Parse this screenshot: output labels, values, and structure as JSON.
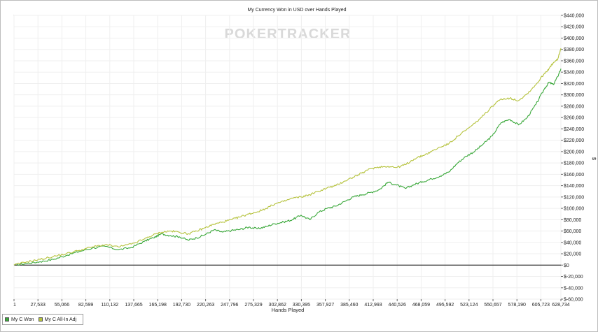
{
  "chart_data": {
    "type": "line",
    "title": "My Currency Won in USD over Hands Played",
    "watermark": "POKERTRACKER",
    "xlabel": "Hands Played",
    "ylabel": "$",
    "xlim": [
      1,
      628734
    ],
    "ylim": [
      -60000,
      440000
    ],
    "x_ticks": [
      "1",
      "27,533",
      "55,066",
      "82,599",
      "110,132",
      "137,665",
      "165,198",
      "192,730",
      "220,263",
      "247,796",
      "275,329",
      "302,862",
      "330,395",
      "357,927",
      "385,460",
      "412,993",
      "440,526",
      "468,059",
      "495,592",
      "523,124",
      "550,657",
      "578,190",
      "605,723",
      "628,734"
    ],
    "x_tick_values": [
      1,
      27533,
      55066,
      82599,
      110132,
      137665,
      165198,
      192730,
      220263,
      247796,
      275329,
      302862,
      330395,
      357927,
      385460,
      412993,
      440526,
      468059,
      495592,
      523124,
      550657,
      578190,
      605723,
      628734
    ],
    "y_ticks": [
      "$440,000",
      "$420,000",
      "$400,000",
      "$380,000",
      "$360,000",
      "$340,000",
      "$320,000",
      "$300,000",
      "$280,000",
      "$260,000",
      "$240,000",
      "$220,000",
      "$200,000",
      "$180,000",
      "$160,000",
      "$140,000",
      "$120,000",
      "$100,000",
      "$80,000",
      "$60,000",
      "$40,000",
      "$20,000",
      "$0",
      "$-20,000",
      "$-40,000",
      "$-60,000"
    ],
    "y_tick_values": [
      440000,
      420000,
      400000,
      380000,
      360000,
      340000,
      320000,
      300000,
      280000,
      260000,
      240000,
      220000,
      200000,
      180000,
      160000,
      140000,
      120000,
      100000,
      80000,
      60000,
      40000,
      20000,
      0,
      -20000,
      -40000,
      -60000
    ],
    "grid": true,
    "legend_position": "bottom-left",
    "colors": {
      "won": "#3aa83a",
      "allin": "#b5c23c",
      "zero_line": "#000000",
      "grid": "#efefef"
    },
    "series": [
      {
        "name": "My C Won",
        "x": [
          0,
          15000,
          30000,
          45000,
          60000,
          75000,
          90000,
          105000,
          120000,
          135000,
          150000,
          160000,
          170000,
          180000,
          190000,
          200000,
          210000,
          220000,
          230000,
          240000,
          250000,
          260000,
          270000,
          280000,
          290000,
          300000,
          310000,
          320000,
          330000,
          340000,
          350000,
          360000,
          370000,
          380000,
          390000,
          400000,
          410000,
          420000,
          430000,
          440000,
          450000,
          460000,
          470000,
          480000,
          490000,
          500000,
          510000,
          520000,
          530000,
          540000,
          550000,
          560000,
          570000,
          580000,
          590000,
          600000,
          610000,
          615000,
          620000,
          625000,
          628734
        ],
        "y": [
          0,
          3000,
          6000,
          10000,
          17000,
          24000,
          30000,
          33000,
          27000,
          31000,
          42000,
          48000,
          55000,
          52000,
          50000,
          44000,
          48000,
          54000,
          62000,
          58000,
          61000,
          63000,
          67000,
          64000,
          68000,
          73000,
          76000,
          80000,
          88000,
          80000,
          93000,
          100000,
          104000,
          112000,
          120000,
          124000,
          128000,
          133000,
          146000,
          141000,
          135000,
          142000,
          147000,
          152000,
          157000,
          164000,
          180000,
          192000,
          201000,
          214000,
          228000,
          251000,
          257000,
          247000,
          260000,
          283000,
          311000,
          322000,
          318000,
          332000,
          346000
        ]
      },
      {
        "name": "My C All-In Adj",
        "x": [
          0,
          15000,
          30000,
          45000,
          60000,
          75000,
          90000,
          105000,
          120000,
          135000,
          150000,
          160000,
          170000,
          180000,
          190000,
          200000,
          210000,
          220000,
          230000,
          240000,
          250000,
          260000,
          270000,
          280000,
          290000,
          300000,
          310000,
          320000,
          330000,
          340000,
          350000,
          360000,
          370000,
          380000,
          390000,
          400000,
          410000,
          420000,
          430000,
          440000,
          450000,
          460000,
          470000,
          480000,
          490000,
          500000,
          510000,
          520000,
          530000,
          540000,
          550000,
          560000,
          570000,
          580000,
          590000,
          600000,
          610000,
          615000,
          620000,
          625000,
          628734
        ],
        "y": [
          0,
          6000,
          10000,
          15000,
          20000,
          26000,
          32000,
          36000,
          32000,
          37000,
          46000,
          53000,
          58000,
          60000,
          58000,
          55000,
          60000,
          66000,
          72000,
          76000,
          80000,
          85000,
          90000,
          94000,
          100000,
          108000,
          112000,
          118000,
          120000,
          124000,
          130000,
          136000,
          140000,
          148000,
          155000,
          162000,
          170000,
          173000,
          174000,
          172000,
          177000,
          187000,
          193000,
          200000,
          208000,
          214000,
          227000,
          238000,
          250000,
          264000,
          280000,
          293000,
          294000,
          290000,
          302000,
          318000,
          338000,
          346000,
          356000,
          362000,
          382000
        ]
      }
    ]
  },
  "legend": {
    "won_label": "My C Won",
    "allin_label": "My C All-In Adj"
  }
}
